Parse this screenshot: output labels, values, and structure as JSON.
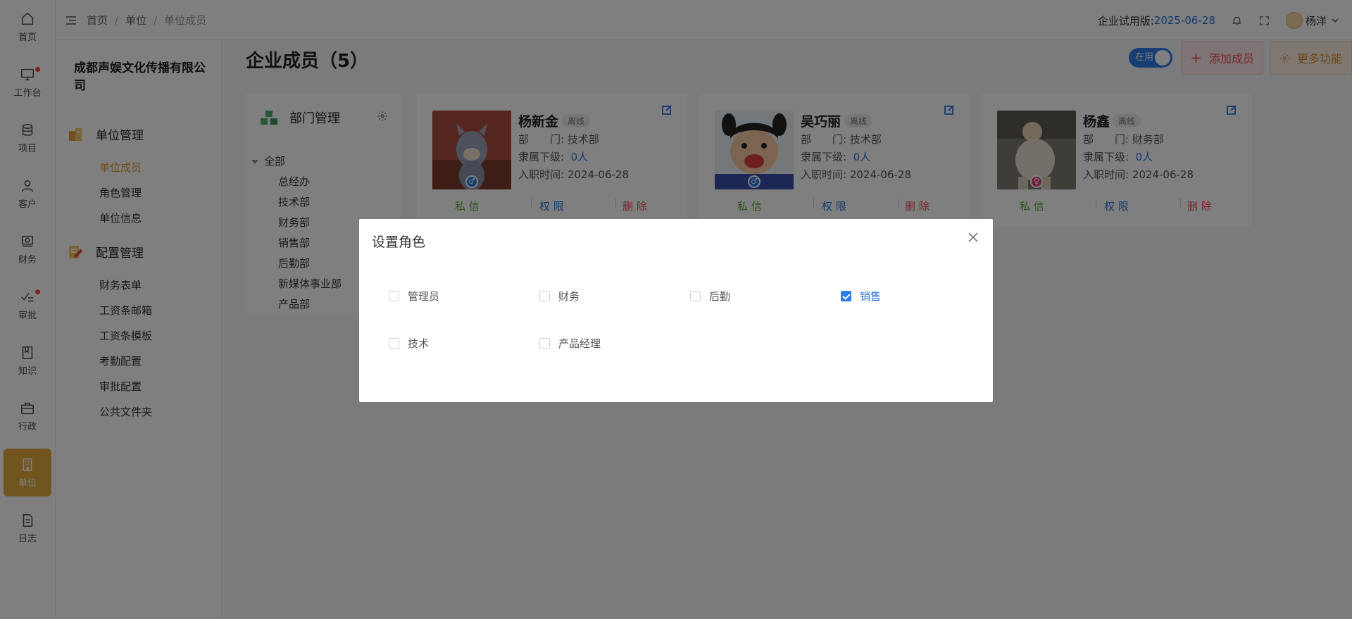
{
  "rail": {
    "items": [
      {
        "label": "首页",
        "icon": "home-icon"
      },
      {
        "label": "工作台",
        "icon": "monitor-icon"
      },
      {
        "label": "项目",
        "icon": "database-icon"
      },
      {
        "label": "客户",
        "icon": "user-icon"
      },
      {
        "label": "财务",
        "icon": "finance-icon"
      },
      {
        "label": "审批",
        "icon": "approve-icon"
      },
      {
        "label": "知识",
        "icon": "book-icon"
      },
      {
        "label": "行政",
        "icon": "briefcase-icon"
      },
      {
        "label": "单位",
        "icon": "building-icon"
      },
      {
        "label": "日志",
        "icon": "log-icon"
      }
    ],
    "active_color": "#e0ad3c"
  },
  "menu": {
    "company": "成都声娱文化传播有限公司",
    "groups": [
      {
        "label": "单位管理",
        "items": [
          "单位成员",
          "角色管理",
          "单位信息"
        ]
      },
      {
        "label": "配置管理",
        "items": [
          "财务表单",
          "工资条邮箱",
          "工资条模板",
          "考勤配置",
          "审批配置",
          "公共文件夹"
        ]
      }
    ]
  },
  "header": {
    "breadcrumb": [
      "首页",
      "单位",
      "单位成员"
    ],
    "trial_label": "企业试用版:",
    "trial_date": "2025-06-28",
    "user": "杨洋"
  },
  "page": {
    "title": "企业成员（5）",
    "toggle_label": "在用",
    "add_button": "添加成员",
    "more_button": "更多功能"
  },
  "dept": {
    "title": "部门管理",
    "all": "全部",
    "nodes": [
      "总经办",
      "技术部",
      "财务部",
      "销售部",
      "后勤部",
      "新媒体事业部",
      "产品部"
    ]
  },
  "members": [
    {
      "name": "杨新金",
      "status": "离线",
      "dept_label": "部　　门:",
      "dept": "技术部",
      "sub_label": "隶属下级:",
      "sub": "0人",
      "join_label": "入职时间:",
      "join": "2024-06-28",
      "gender": "male"
    },
    {
      "name": "吴巧丽",
      "status": "离线",
      "dept_label": "部　　门:",
      "dept": "技术部",
      "sub_label": "隶属下级:",
      "sub": "0人",
      "join_label": "入职时间:",
      "join": "2024-06-28",
      "gender": "male"
    },
    {
      "name": "杨鑫",
      "status": "离线",
      "dept_label": "部　　门:",
      "dept": "财务部",
      "sub_label": "隶属下级:",
      "sub": "0人",
      "join_label": "入职时间:",
      "join": "2024-06-28",
      "gender": "female"
    }
  ],
  "actions": {
    "message": "私 信",
    "permission": "权 限",
    "delete": "删 除"
  },
  "dialog": {
    "title": "设置角色",
    "roles": [
      {
        "label": "管理员",
        "checked": false
      },
      {
        "label": "财务",
        "checked": false
      },
      {
        "label": "后勤",
        "checked": false
      },
      {
        "label": "销售",
        "checked": true
      },
      {
        "label": "技术",
        "checked": false
      },
      {
        "label": "产品经理",
        "checked": false
      }
    ]
  }
}
